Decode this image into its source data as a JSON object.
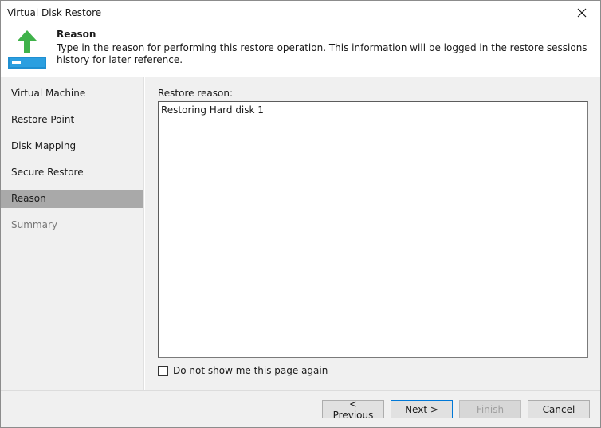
{
  "window": {
    "title": "Virtual Disk Restore"
  },
  "header": {
    "title": "Reason",
    "description": "Type in the reason for performing this restore operation. This information will be logged in the restore sessions history for later reference.",
    "icon": "restore-disk-icon",
    "accent_color": "#3fb24a"
  },
  "sidebar": {
    "items": [
      {
        "label": "Virtual Machine",
        "state": "normal"
      },
      {
        "label": "Restore Point",
        "state": "normal"
      },
      {
        "label": "Disk Mapping",
        "state": "normal"
      },
      {
        "label": "Secure Restore",
        "state": "normal"
      },
      {
        "label": "Reason",
        "state": "active"
      },
      {
        "label": "Summary",
        "state": "disabled"
      }
    ]
  },
  "main": {
    "field_label": "Restore reason:",
    "reason_value": "Restoring Hard disk 1",
    "checkbox_label": "Do not show me this page again",
    "checkbox_checked": false
  },
  "footer": {
    "previous_label": "< Previous",
    "next_label": "Next >",
    "finish_label": "Finish",
    "cancel_label": "Cancel"
  }
}
